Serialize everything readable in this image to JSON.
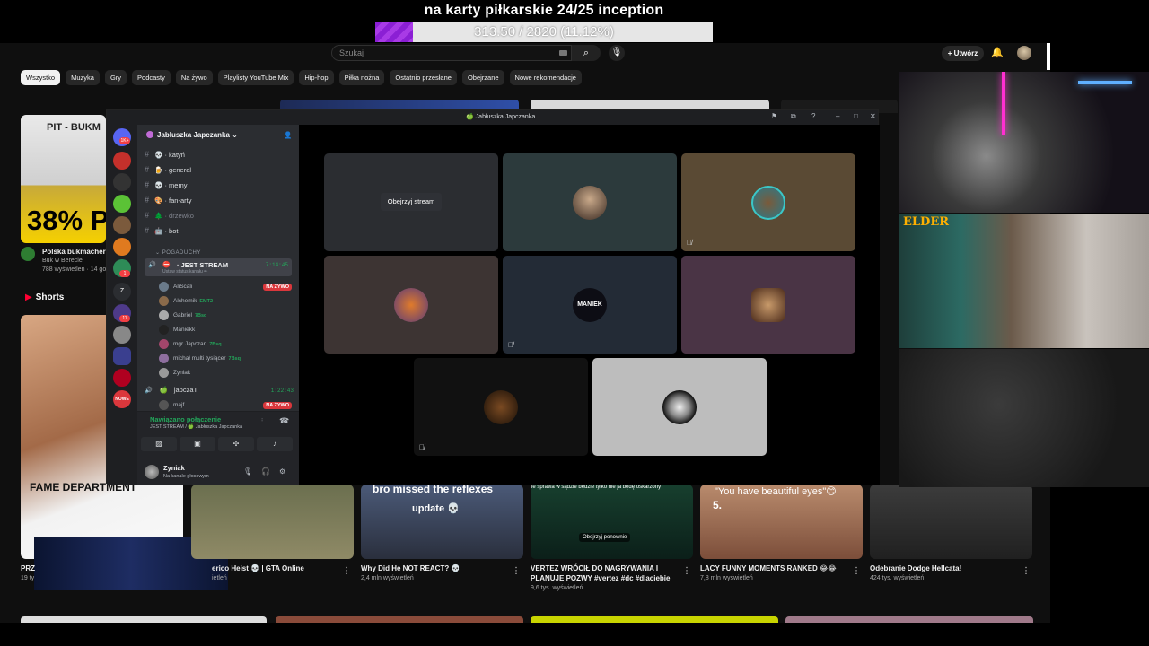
{
  "overlay": {
    "title": "na karty piłkarskie 24/25 inception",
    "progress_text": "313.50 / 2820 (11.12%)",
    "progress_fraction": 0.1112
  },
  "youtube": {
    "search_placeholder": "Szukaj",
    "create_label": "Utwórz",
    "chips": [
      "Wszystko",
      "Muzyka",
      "Gry",
      "Podcasty",
      "Na żywo",
      "Playlisty YouTube Mix",
      "Hip-hop",
      "Piłka nożna",
      "Ostatnio przesłane",
      "Obejrzane",
      "Nowe rekomendacje"
    ],
    "video1": {
      "thumb_title": "PIT - BUKM",
      "thumb_big": "38% P",
      "title": "Polska bukmacherk",
      "channel": "Buk w Berecie",
      "meta": "788 wyświetleń · 14 god"
    },
    "shorts_label": "Shorts",
    "shorts": [
      {
        "thumb_text": "FAME DEPARTMENT",
        "title": "PRZ",
        "meta": "19 ty"
      },
      {
        "title": "erico Heist 💀 | GTA Online",
        "meta": "ietleń"
      },
      {
        "thumb_text": "bro missed the reflexes",
        "thumb_sub": "update 💀",
        "title": "Why Did He NOT REACT? 💀",
        "meta": "2,4 mln wyświetleń"
      },
      {
        "thumb_text": "ie sprawa w sądzie będzie tylko nie ja będę oskarżony\"",
        "button": "Obejrzyj ponownie",
        "title": "VERTEZ WRÓCIŁ DO NAGRYWANIA I",
        "title2": "PLANUJE POZWY #vertez #dc #dlaciebie",
        "meta": "9,6 tys. wyświetleń"
      },
      {
        "thumb_text": "\"You have beautiful eyes\"😊",
        "thumb_num": "5.",
        "title": "LACY FUNNY MOMENTS RANKED 😂😂",
        "meta": "7,8 mln wyświetleń"
      },
      {
        "title": "Odebranie Dodge Hellcata!",
        "meta": "424 tys. wyświetleń"
      }
    ]
  },
  "cams": {
    "tag2": "ELDER"
  },
  "discord": {
    "window_title": "Jabłuszka Japczanka",
    "guild_name": "Jabłuszka Japczanka",
    "server_badges": [
      "1K+",
      "11",
      "1"
    ],
    "server_labels": [
      "Z",
      "NOWE"
    ],
    "text_channels": [
      "katyń",
      "general",
      "memy",
      "fan-arty",
      "drzewko",
      "bot"
    ],
    "category": "POGADUCHY",
    "voice1": {
      "name": "JEST STREAM",
      "status": "Ustaw status kanału ✏",
      "time": "7:14:45"
    },
    "members": [
      {
        "name": "AliScali",
        "badge": "",
        "live": true
      },
      {
        "name": "Alchemik",
        "badge": "EMT2",
        "live": false
      },
      {
        "name": "Gabriel",
        "badge": "7Bsq",
        "live": false
      },
      {
        "name": "Maniekk",
        "badge": "",
        "live": false
      },
      {
        "name": "mgr Japczan",
        "badge": "7Bsq",
        "live": false
      },
      {
        "name": "michał multi tysiącer",
        "badge": "7Bsq",
        "live": false
      },
      {
        "name": "Zyniak",
        "badge": "",
        "live": false
      }
    ],
    "live_label": "NA ŻYWO",
    "voice2": {
      "name": "japczaT",
      "time": "1:22:43"
    },
    "voice2_member": "majf",
    "connection": {
      "title": "Nawiązano połączenie",
      "sub": "JEST STREAM / 🍏 Jabłuszka Japczanka"
    },
    "user": {
      "name": "Zyniak",
      "status": "Na kanale głosowym"
    },
    "watch_stream": "Obejrzyj stream",
    "tile_names": [
      "MANIEK"
    ]
  },
  "colors": {
    "discord_bg": "#2b2d31",
    "green": "#23a55a",
    "live_red": "#da373c",
    "progress": "#8b1fd4"
  }
}
